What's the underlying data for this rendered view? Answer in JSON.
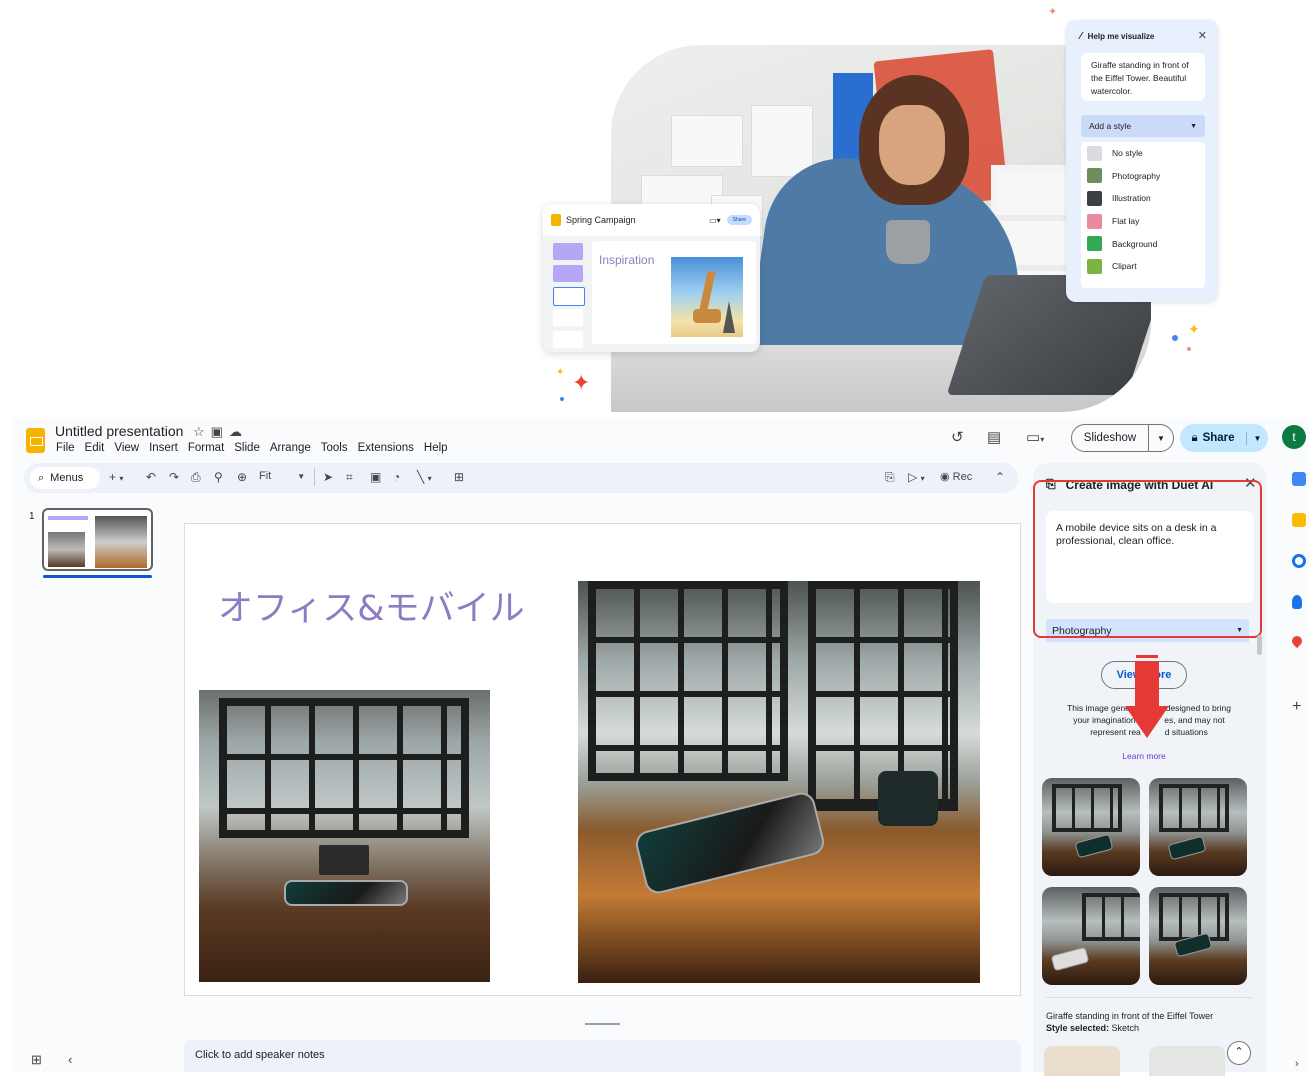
{
  "hero": {
    "mini_card": {
      "title": "Spring Campaign",
      "share_label": "Share",
      "slide_title": "Inspiration"
    },
    "visualize_panel": {
      "title": "Help me visualize",
      "prompt": "Giraffe standing in front of the Eiffel Tower. Beautiful watercolor.",
      "style_button": "Add a style",
      "options": [
        {
          "label": "No style",
          "color": "#dadce0"
        },
        {
          "label": "Photography",
          "color": "#6b8e5a"
        },
        {
          "label": "Illustration",
          "color": "#3c4043"
        },
        {
          "label": "Flat lay",
          "color": "#e98aa0"
        },
        {
          "label": "Background",
          "color": "#34a853"
        },
        {
          "label": "Clipart",
          "color": "#7cb342"
        }
      ]
    }
  },
  "app": {
    "doc_title": "Untitled presentation",
    "menu": [
      "File",
      "Edit",
      "View",
      "Insert",
      "Format",
      "Slide",
      "Arrange",
      "Tools",
      "Extensions",
      "Help"
    ],
    "slideshow_label": "Slideshow",
    "share_label": "Share",
    "avatar_letter": "t",
    "toolbar": {
      "menus_label": "Menus",
      "zoom_label": "Fit",
      "rec_label": "Rec"
    },
    "filmstrip": {
      "slide_number": "1"
    },
    "slide": {
      "title": "オフィス&モバイル"
    },
    "notes_placeholder": "Click to add speaker notes"
  },
  "ai_panel": {
    "title": "Create image with Duet AI",
    "prompt": "A mobile device sits on a desk in a professional, clean office.",
    "style_selected": "Photography",
    "view_button": "View more",
    "disclaimer_parts": [
      "This image generati",
      "designed to bring",
      "your imagination t",
      "es, and may not",
      "represent rea",
      "d situations"
    ],
    "learn_more": "Learn more",
    "history_prompt": "Giraffe standing in front of the Eiffel Tower",
    "history_style_label": "Style selected:",
    "history_style_value": "Sketch"
  },
  "colors": {
    "accent_red": "#e53935",
    "slides_yellow": "#f4b400",
    "title_purple": "#8e7cc3",
    "share_blue": "#c2e7ff"
  }
}
